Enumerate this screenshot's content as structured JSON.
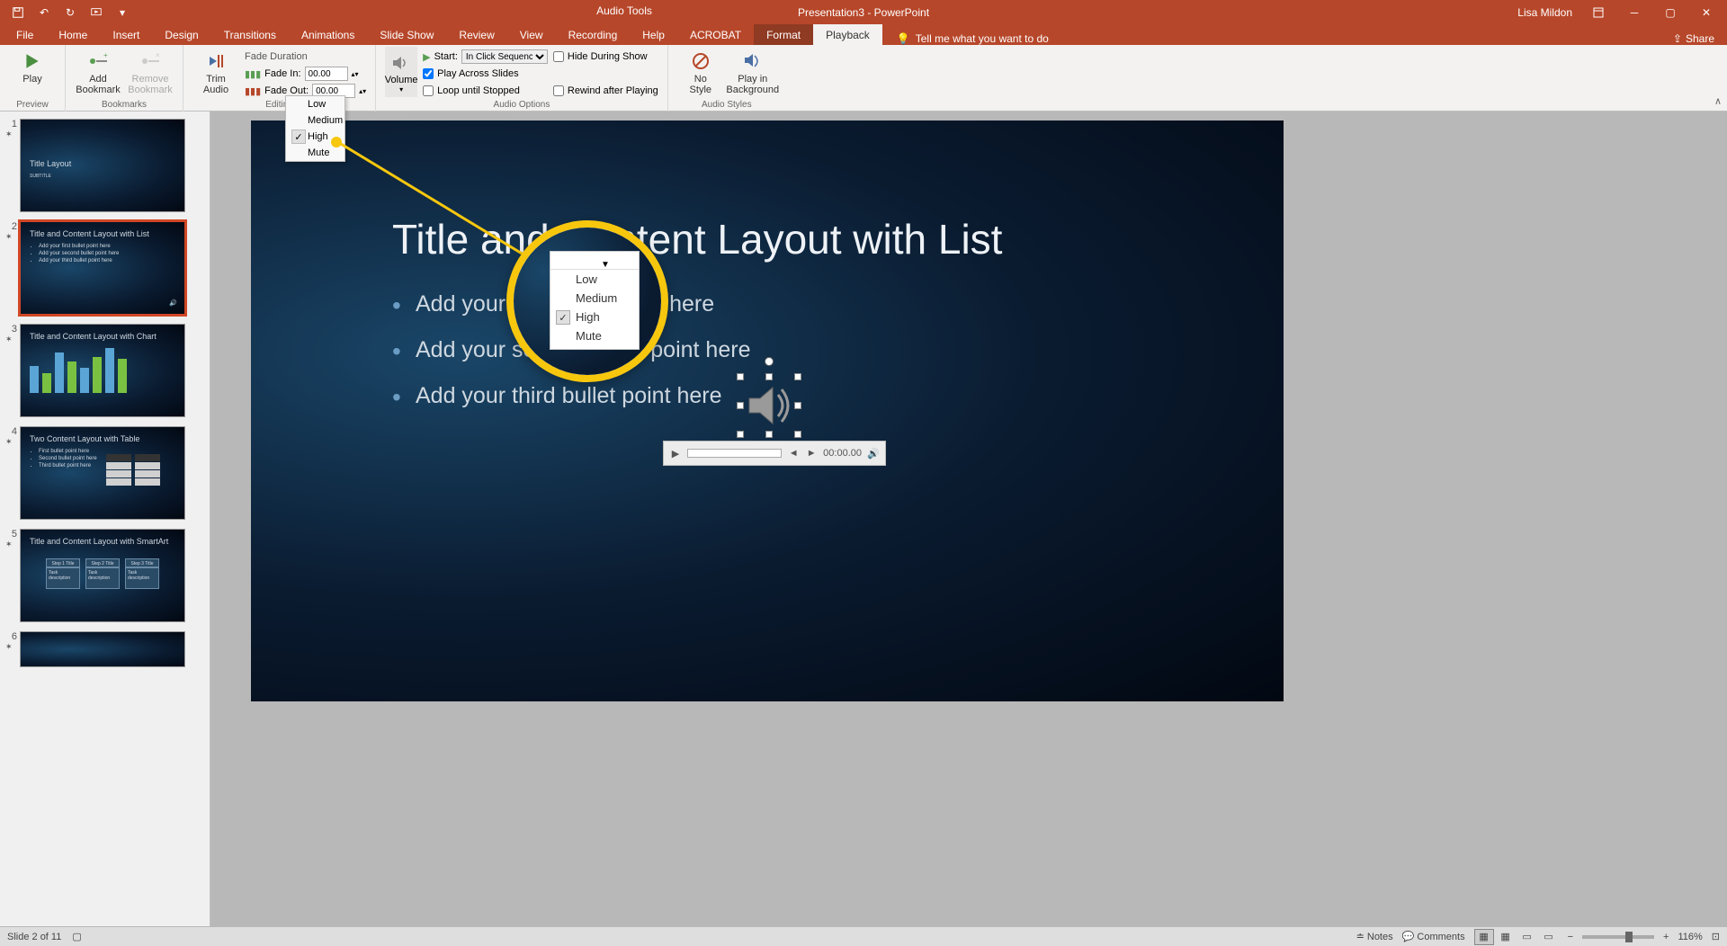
{
  "titlebar": {
    "doc": "Presentation3 - PowerPoint",
    "context_tool": "Audio Tools",
    "user": "Lisa Mildon"
  },
  "tabs": {
    "file": "File",
    "home": "Home",
    "insert": "Insert",
    "design": "Design",
    "transitions": "Transitions",
    "animations": "Animations",
    "slideshow": "Slide Show",
    "review": "Review",
    "view": "View",
    "recording": "Recording",
    "help": "Help",
    "acrobat": "ACROBAT",
    "format": "Format",
    "playback": "Playback",
    "tellme": "Tell me what you want to do",
    "share": "Share"
  },
  "ribbon": {
    "preview": {
      "play": "Play",
      "group": "Preview"
    },
    "bookmarks": {
      "add": "Add\nBookmark",
      "remove": "Remove\nBookmark",
      "group": "Bookmarks"
    },
    "editing": {
      "trim": "Trim\nAudio",
      "fade_duration": "Fade Duration",
      "fade_in": "Fade In:",
      "fade_in_val": "00.00",
      "fade_out": "Fade Out:",
      "fade_out_val": "00.00",
      "group": "Editing"
    },
    "audio_opts": {
      "volume": "Volume",
      "start": "Start:",
      "start_val": "In Click Sequence",
      "play_across": "Play Across Slides",
      "loop": "Loop until Stopped",
      "hide": "Hide During Show",
      "rewind": "Rewind after Playing",
      "group": "Audio Options"
    },
    "audio_styles": {
      "none": "No\nStyle",
      "bg": "Play in\nBackground",
      "group": "Audio Styles"
    }
  },
  "vol_menu": {
    "low": "Low",
    "medium": "Medium",
    "high": "High",
    "mute": "Mute"
  },
  "slide": {
    "title": "Title and Content Layout with List",
    "b1": "Add your first bullet point here",
    "b2": "Add your second bullet point here",
    "b3": "Add your third bullet point here"
  },
  "audio_bar": {
    "time": "00:00.00"
  },
  "thumbs": {
    "t1": {
      "title": "Title Layout",
      "sub": "SUBTITLE"
    },
    "t2": {
      "title": "Title and Content Layout with List",
      "b1": "Add your first bullet point here",
      "b2": "Add your second bullet point here",
      "b3": "Add your third bullet point here"
    },
    "t3": {
      "title": "Title and Content Layout with Chart"
    },
    "t4": {
      "title": "Two Content Layout with Table",
      "b1": "First bullet point here",
      "b2": "Second bullet point here",
      "b3": "Third bullet point here"
    },
    "t5": {
      "title": "Title and Content Layout with SmartArt",
      "s1": "Step 1 Title",
      "s2": "Step 2 Title",
      "s3": "Step 3 Title",
      "d": "Task description"
    }
  },
  "statusbar": {
    "slide_of": "Slide 2 of 11",
    "notes": "Notes",
    "comments": "Comments",
    "zoom": "116%"
  },
  "magnifier": {
    "low": "Low",
    "medium": "Medium",
    "high": "High",
    "mute": "Mute"
  }
}
